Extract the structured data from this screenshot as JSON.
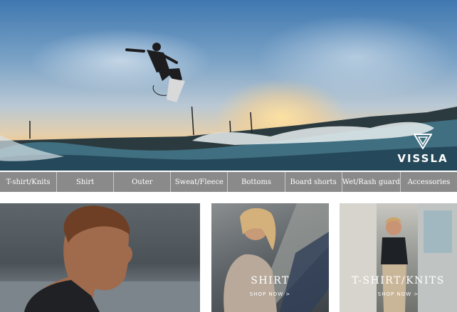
{
  "hero": {
    "brand": "VISSLA",
    "icon": "vissla-v-logo"
  },
  "nav": {
    "items": [
      {
        "label": "T-shirt/Knits"
      },
      {
        "label": "Shirt"
      },
      {
        "label": "Outer"
      },
      {
        "label": "Sweat/Fleece"
      },
      {
        "label": "Bottoms"
      },
      {
        "label": "Board shorts"
      },
      {
        "label": "Wet/Rash guard"
      },
      {
        "label": "Accessories"
      }
    ]
  },
  "promos": {
    "shirt": {
      "title": "SHIRT",
      "link": "SHOP NOW >"
    },
    "tshirt": {
      "title": "T-SHIRT/KNITS",
      "link": "SHOP NOW >"
    }
  },
  "colors": {
    "nav_bg": "#8a8a8a",
    "nav_divider": "#c9c9c9",
    "text_light": "#ffffff"
  }
}
